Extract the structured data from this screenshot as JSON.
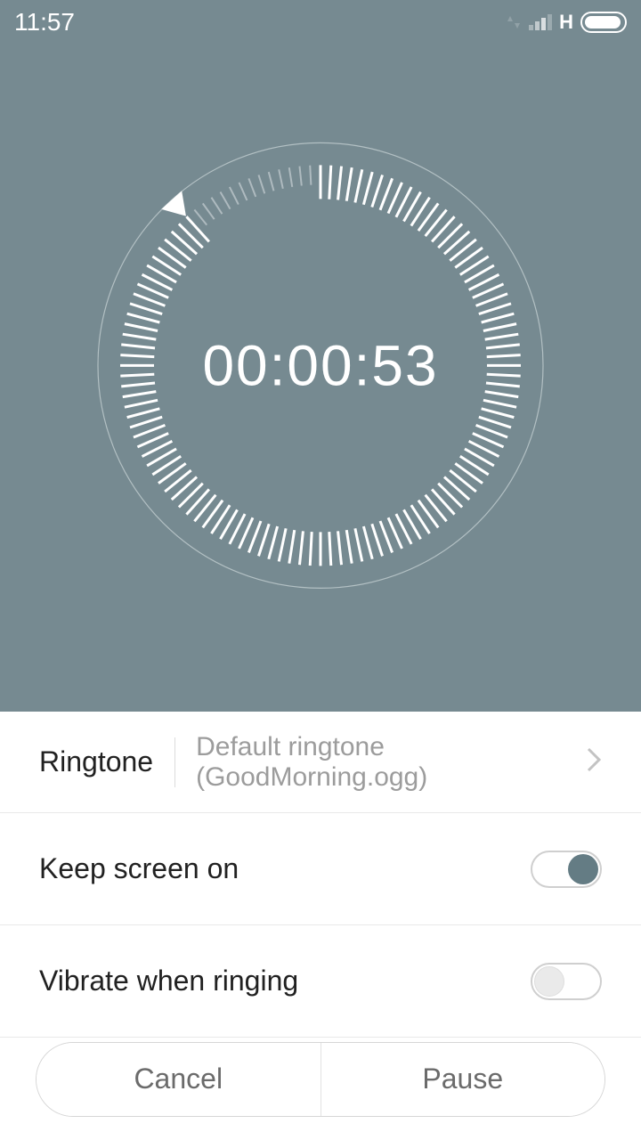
{
  "status": {
    "time": "11:57",
    "network": "H"
  },
  "timer": {
    "display": "00:00:53",
    "total_seconds": 60,
    "remaining_seconds": 53
  },
  "settings": {
    "ringtone": {
      "label": "Ringtone",
      "value": "Default ringtone (GoodMorning.ogg)"
    },
    "keep_screen": {
      "label": "Keep screen on",
      "on": true
    },
    "vibrate": {
      "label": "Vibrate when ringing",
      "on": false
    }
  },
  "buttons": {
    "cancel": "Cancel",
    "pause": "Pause"
  }
}
